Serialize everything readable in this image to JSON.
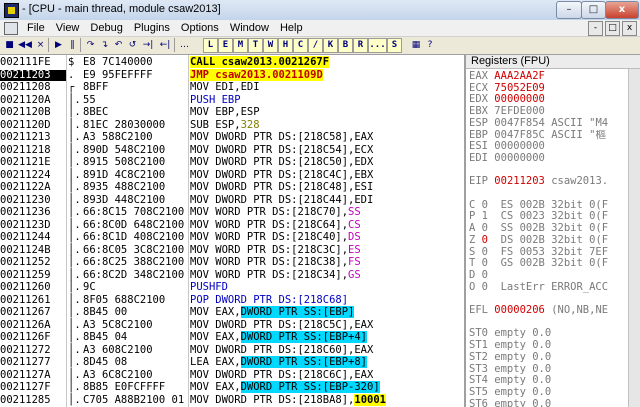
{
  "window": {
    "title": "- [CPU - main thread, module csaw2013]",
    "min_label": "–",
    "max_label": "□",
    "close_label": "x"
  },
  "menubar": {
    "items": [
      "File",
      "View",
      "Debug",
      "Plugins",
      "Options",
      "Window",
      "Help"
    ],
    "right_buttons": [
      "-",
      "□",
      "x"
    ]
  },
  "toolbar": {
    "buttons": [
      "■",
      "◀◀",
      "×",
      "▶",
      "‖",
      "↷",
      "↴",
      "↶",
      "↺",
      "→|",
      "←|",
      "…"
    ],
    "letters": [
      "L",
      "E",
      "M",
      "T",
      "W",
      "H",
      "C",
      "/",
      "K",
      "B",
      "R",
      "...",
      "S"
    ],
    "icons": [
      "grid-icon",
      "question-icon"
    ]
  },
  "disasm": {
    "rows": [
      {
        "addr": "002111FE",
        "flag": "$",
        "hex": "E8 7C140000",
        "ins": [
          {
            "t": "CALL ",
            "c": "ins-call"
          },
          {
            "t": "csaw2013.0021267F",
            "c": "ins-call"
          }
        ]
      },
      {
        "addr": "00211203",
        "flag": ".",
        "hex": "E9 95FEFFFF",
        "ins": [
          {
            "t": "JMP ",
            "c": "ins-jmp"
          },
          {
            "t": "csaw2013.0021109D",
            "c": "ins-jmp"
          }
        ],
        "sel": true
      },
      {
        "addr": "00211208",
        "flag": "┌",
        "hex": "8BFF",
        "ins": [
          {
            "t": "MOV EDI,EDI",
            "c": ""
          }
        ]
      },
      {
        "addr": "0021120A",
        "flag": "│.",
        "hex": "55",
        "ins": [
          {
            "t": "PUSH EBP",
            "c": "blue"
          }
        ]
      },
      {
        "addr": "0021120B",
        "flag": "│.",
        "hex": "8BEC",
        "ins": [
          {
            "t": "MOV EBP,ESP",
            "c": ""
          }
        ]
      },
      {
        "addr": "0021120D",
        "flag": "│.",
        "hex": "81EC 28030000",
        "ins": [
          {
            "t": "SUB ESP,",
            "c": ""
          },
          {
            "t": "328",
            "c": "olive"
          }
        ]
      },
      {
        "addr": "00211213",
        "flag": "│.",
        "hex": "A3 588C2100",
        "ins": [
          {
            "t": "MOV DWORD PTR DS:[218C58],EAX",
            "c": ""
          }
        ]
      },
      {
        "addr": "00211218",
        "flag": "│.",
        "hex": "890D 548C2100",
        "ins": [
          {
            "t": "MOV DWORD PTR DS:[218C54],ECX",
            "c": ""
          }
        ]
      },
      {
        "addr": "0021121E",
        "flag": "│.",
        "hex": "8915 508C2100",
        "ins": [
          {
            "t": "MOV DWORD PTR DS:[218C50],EDX",
            "c": ""
          }
        ]
      },
      {
        "addr": "00211224",
        "flag": "│.",
        "hex": "891D 4C8C2100",
        "ins": [
          {
            "t": "MOV DWORD PTR DS:[218C4C],EBX",
            "c": ""
          }
        ]
      },
      {
        "addr": "0021122A",
        "flag": "│.",
        "hex": "8935 488C2100",
        "ins": [
          {
            "t": "MOV DWORD PTR DS:[218C48],ESI",
            "c": ""
          }
        ]
      },
      {
        "addr": "00211230",
        "flag": "│.",
        "hex": "893D 448C2100",
        "ins": [
          {
            "t": "MOV DWORD PTR DS:[218C44],EDI",
            "c": ""
          }
        ]
      },
      {
        "addr": "00211236",
        "flag": "│.",
        "hex": "66:8C15 708C2100",
        "ins": [
          {
            "t": "MOV WORD PTR DS:[218C70],",
            "c": ""
          },
          {
            "t": "SS",
            "c": "mag"
          }
        ]
      },
      {
        "addr": "0021123D",
        "flag": "│.",
        "hex": "66:8C0D 648C2100",
        "ins": [
          {
            "t": "MOV WORD PTR DS:[218C64],",
            "c": ""
          },
          {
            "t": "CS",
            "c": "mag"
          }
        ]
      },
      {
        "addr": "00211244",
        "flag": "│.",
        "hex": "66:8C1D 408C2100",
        "ins": [
          {
            "t": "MOV WORD PTR DS:[218C40],",
            "c": ""
          },
          {
            "t": "DS",
            "c": "mag"
          }
        ]
      },
      {
        "addr": "0021124B",
        "flag": "│.",
        "hex": "66:8C05 3C8C2100",
        "ins": [
          {
            "t": "MOV WORD PTR DS:[218C3C],",
            "c": ""
          },
          {
            "t": "ES",
            "c": "mag"
          }
        ]
      },
      {
        "addr": "00211252",
        "flag": "│.",
        "hex": "66:8C25 388C2100",
        "ins": [
          {
            "t": "MOV WORD PTR DS:[218C38],",
            "c": ""
          },
          {
            "t": "FS",
            "c": "mag"
          }
        ]
      },
      {
        "addr": "00211259",
        "flag": "│.",
        "hex": "66:8C2D 348C2100",
        "ins": [
          {
            "t": "MOV WORD PTR DS:[218C34],",
            "c": ""
          },
          {
            "t": "GS",
            "c": "mag"
          }
        ]
      },
      {
        "addr": "00211260",
        "flag": "│.",
        "hex": "9C",
        "ins": [
          {
            "t": "PUSHFD",
            "c": "blue"
          }
        ]
      },
      {
        "addr": "00211261",
        "flag": "│.",
        "hex": "8F05 688C2100",
        "ins": [
          {
            "t": "POP DWORD PTR DS:[218C68]",
            "c": "blue"
          }
        ]
      },
      {
        "addr": "00211267",
        "flag": "│.",
        "hex": "8B45 00",
        "ins": [
          {
            "t": "MOV EAX,",
            "c": ""
          },
          {
            "t": "DWORD PTR SS:[EBP]",
            "c": "ss"
          }
        ]
      },
      {
        "addr": "0021126A",
        "flag": "│.",
        "hex": "A3 5C8C2100",
        "ins": [
          {
            "t": "MOV DWORD PTR DS:[218C5C],EAX",
            "c": ""
          }
        ]
      },
      {
        "addr": "0021126F",
        "flag": "│.",
        "hex": "8B45 04",
        "ins": [
          {
            "t": "MOV EAX,",
            "c": ""
          },
          {
            "t": "DWORD PTR SS:[EBP+4]",
            "c": "ss"
          }
        ]
      },
      {
        "addr": "00211272",
        "flag": "│.",
        "hex": "A3 608C2100",
        "ins": [
          {
            "t": "MOV DWORD PTR DS:[218C60],EAX",
            "c": ""
          }
        ]
      },
      {
        "addr": "00211277",
        "flag": "│.",
        "hex": "8D45 08",
        "ins": [
          {
            "t": "LEA EAX,",
            "c": ""
          },
          {
            "t": "DWORD PTR SS:[EBP+8]",
            "c": "ss"
          }
        ]
      },
      {
        "addr": "0021127A",
        "flag": "│.",
        "hex": "A3 6C8C2100",
        "ins": [
          {
            "t": "MOV DWORD PTR DS:[218C6C],EAX",
            "c": ""
          }
        ]
      },
      {
        "addr": "0021127F",
        "flag": "│.",
        "hex": "8B85 E0FCFFFF",
        "ins": [
          {
            "t": "MOV EAX,",
            "c": ""
          },
          {
            "t": "DWORD PTR SS:[EBP-320]",
            "c": "ss"
          }
        ]
      },
      {
        "addr": "00211285",
        "flag": "│.",
        "hex": "C705 A88B2100 01",
        "ins": [
          {
            "t": "MOV DWORD PTR DS:[218BA8],",
            "c": ""
          },
          {
            "t": "10001",
            "c": "hlnum"
          }
        ]
      }
    ]
  },
  "registers": {
    "header": "Registers (FPU)",
    "lines": [
      [
        {
          "t": "EAX ",
          "c": "gray"
        },
        {
          "t": "AAA2AA2F",
          "c": "red"
        }
      ],
      [
        {
          "t": "ECX ",
          "c": "gray"
        },
        {
          "t": "75052E09",
          "c": "red"
        }
      ],
      [
        {
          "t": "EDX ",
          "c": "gray"
        },
        {
          "t": "00000000",
          "c": "red"
        }
      ],
      [
        {
          "t": "EBX ",
          "c": "gray"
        },
        {
          "t": "7EFDE000",
          "c": "gray"
        }
      ],
      [
        {
          "t": "ESP ",
          "c": "gray"
        },
        {
          "t": "0047F854 ASCII \"M4",
          "c": "gray"
        }
      ],
      [
        {
          "t": "EBP ",
          "c": "gray"
        },
        {
          "t": "0047F85C ASCII \"樞",
          "c": "gray"
        }
      ],
      [
        {
          "t": "ESI ",
          "c": "gray"
        },
        {
          "t": "00000000",
          "c": "gray"
        }
      ],
      [
        {
          "t": "EDI ",
          "c": "gray"
        },
        {
          "t": "00000000",
          "c": "gray"
        }
      ],
      [
        {
          "t": "",
          "c": ""
        }
      ],
      [
        {
          "t": "EIP ",
          "c": "gray"
        },
        {
          "t": "00211203",
          "c": "red"
        },
        {
          "t": " csaw2013.",
          "c": "gray"
        }
      ],
      [
        {
          "t": "",
          "c": ""
        }
      ],
      [
        {
          "t": "C 0  ",
          "c": "gray"
        },
        {
          "t": "ES 002B 32bit 0(F",
          "c": "gray"
        }
      ],
      [
        {
          "t": "P 1  ",
          "c": "gray"
        },
        {
          "t": "CS 0023 32bit 0(F",
          "c": "gray"
        }
      ],
      [
        {
          "t": "A 0  ",
          "c": "gray"
        },
        {
          "t": "SS 002B 32bit 0(F",
          "c": "gray"
        }
      ],
      [
        {
          "t": "Z ",
          "c": "gray"
        },
        {
          "t": "0",
          "c": "red"
        },
        {
          "t": "  DS 002B 32bit 0(F",
          "c": "gray"
        }
      ],
      [
        {
          "t": "S 0  ",
          "c": "gray"
        },
        {
          "t": "FS 0053 32bit 7EF",
          "c": "gray"
        }
      ],
      [
        {
          "t": "T 0  ",
          "c": "gray"
        },
        {
          "t": "GS 002B 32bit 0(F",
          "c": "gray"
        }
      ],
      [
        {
          "t": "D 0",
          "c": "gray"
        }
      ],
      [
        {
          "t": "O 0  ",
          "c": "gray"
        },
        {
          "t": "LastErr ERROR_ACC",
          "c": "gray"
        }
      ],
      [
        {
          "t": "",
          "c": ""
        }
      ],
      [
        {
          "t": "EFL ",
          "c": "gray"
        },
        {
          "t": "00000206",
          "c": "red"
        },
        {
          "t": " (NO,NB,NE",
          "c": "gray"
        }
      ],
      [
        {
          "t": "",
          "c": ""
        }
      ],
      [
        {
          "t": "ST0 empty 0.0",
          "c": "gray"
        }
      ],
      [
        {
          "t": "ST1 empty 0.0",
          "c": "gray"
        }
      ],
      [
        {
          "t": "ST2 empty 0.0",
          "c": "gray"
        }
      ],
      [
        {
          "t": "ST3 empty 0.0",
          "c": "gray"
        }
      ],
      [
        {
          "t": "ST4 empty 0.0",
          "c": "gray"
        }
      ],
      [
        {
          "t": "ST5 empty 0.0",
          "c": "gray"
        }
      ],
      [
        {
          "t": "ST6 empty 0.0",
          "c": "gray"
        }
      ]
    ]
  },
  "colors": {
    "call_bg": "#ffff00",
    "ss_bg": "#00d8ff",
    "changed_reg": "#d00000"
  }
}
